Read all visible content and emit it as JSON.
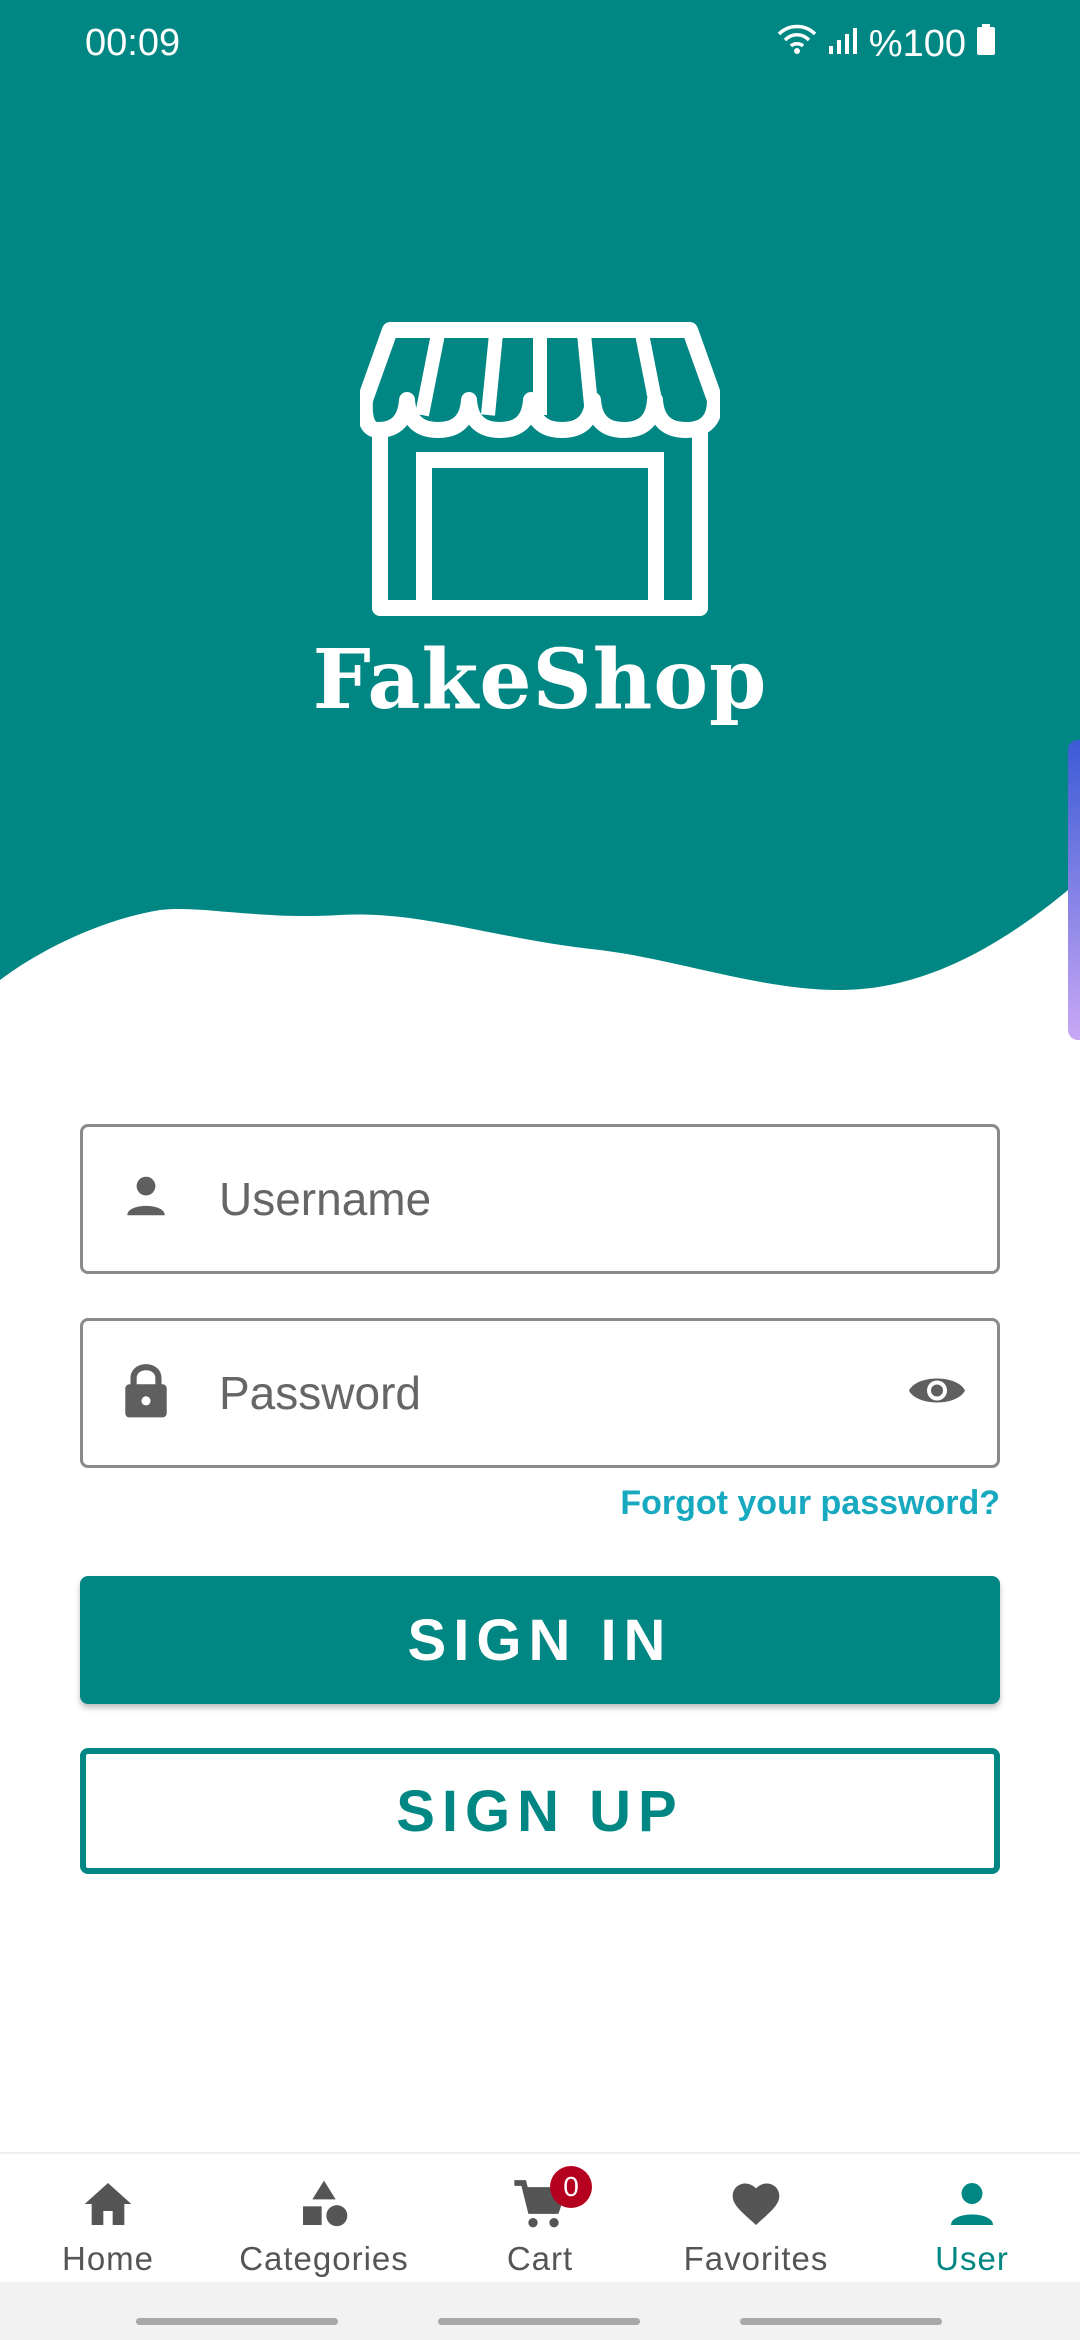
{
  "status_bar": {
    "time": "00:09",
    "battery": "%100",
    "icons": [
      "wifi-icon",
      "signal-icon",
      "battery-icon"
    ]
  },
  "header": {
    "brand": "FakeShop",
    "logo_icon": "storefront-icon",
    "color": "#008783"
  },
  "form": {
    "username_placeholder": "Username",
    "password_placeholder": "Password",
    "username_icon": "person-icon",
    "password_icon": "lock-icon",
    "visibility_icon": "eye-icon",
    "forgot_label": "Forgot your password?"
  },
  "buttons": {
    "sign_in": "SIGN IN",
    "sign_up": "SIGN UP"
  },
  "bottom_nav": {
    "items": [
      {
        "label": "Home",
        "icon": "home-icon"
      },
      {
        "label": "Categories",
        "icon": "categories-icon"
      },
      {
        "label": "Cart",
        "icon": "cart-icon",
        "badge": "0"
      },
      {
        "label": "Favorites",
        "icon": "heart-icon"
      },
      {
        "label": "User",
        "icon": "user-icon",
        "active": true
      }
    ]
  },
  "colors": {
    "primary": "#008783",
    "link": "#17a9bf",
    "badge": "#b5001f"
  }
}
